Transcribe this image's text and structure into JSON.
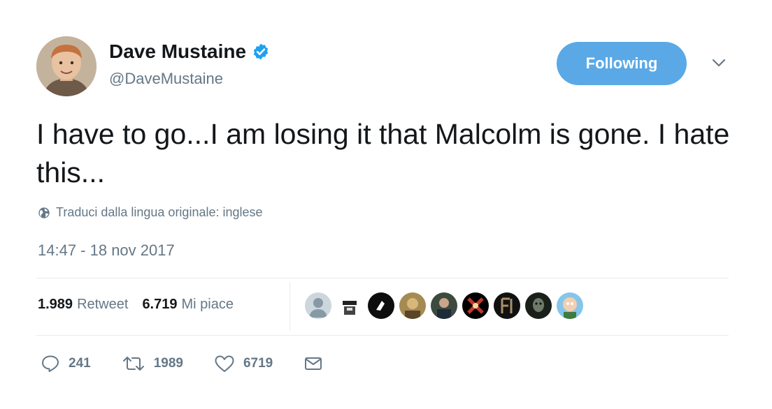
{
  "user": {
    "display_name": "Dave Mustaine",
    "handle": "@DaveMustaine",
    "verified_icon": "verified-badge-icon",
    "avatar": "avatar-photo"
  },
  "follow_button": {
    "label": "Following"
  },
  "menu": {
    "icon": "chevron-down-icon"
  },
  "tweet": {
    "text": "I have to go...I am losing it that Malcolm is gone. I hate this...",
    "translate_label": "Traduci dalla lingua originale: inglese",
    "translate_icon": "globe-icon",
    "timestamp": "14:47 - 18 nov 2017"
  },
  "stats": {
    "retweets_count": "1.989",
    "retweets_label": "Retweet",
    "likes_count": "6.719",
    "likes_label": "Mi piace"
  },
  "likers": [
    "liker-avatar-default",
    "liker-avatar-2",
    "liker-avatar-3",
    "liker-avatar-4",
    "liker-avatar-5",
    "liker-avatar-6",
    "liker-avatar-7",
    "liker-avatar-8",
    "liker-avatar-9",
    "liker-avatar-10"
  ],
  "actions": {
    "reply_count": "241",
    "retweet_count": "1989",
    "like_count": "6719",
    "icons": [
      "reply-icon",
      "retweet-icon",
      "like-icon",
      "message-icon"
    ]
  },
  "colors": {
    "accent": "#5aa9e6",
    "verified": "#1da1f2",
    "text": "#14171a",
    "secondary_text": "#657786",
    "divider": "#e6ecf0"
  }
}
